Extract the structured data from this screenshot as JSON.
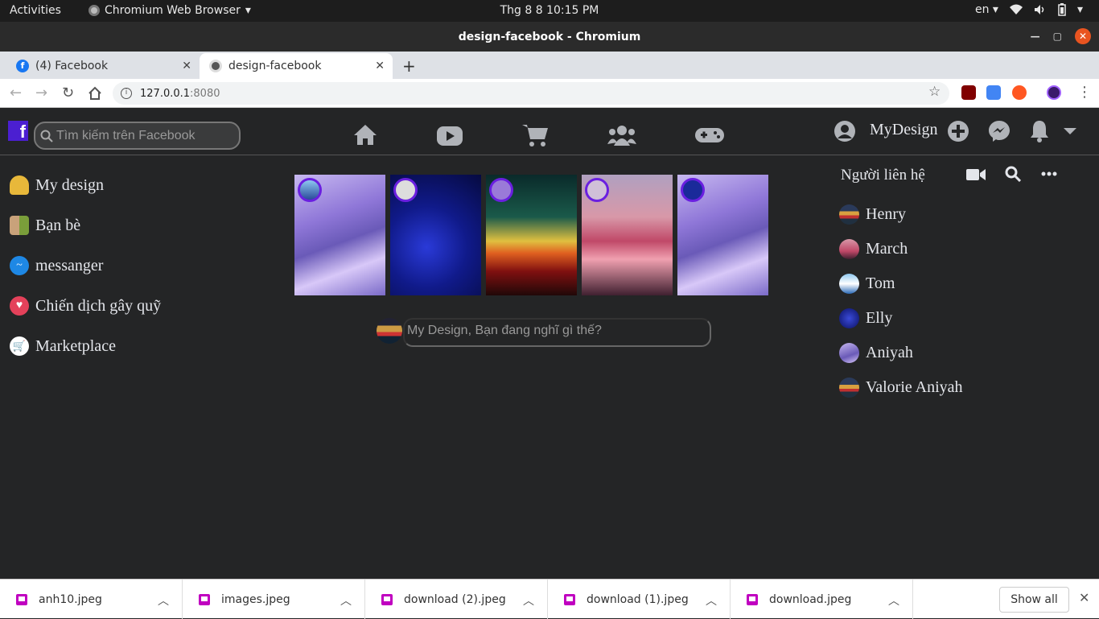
{
  "system_bar": {
    "activities": "Activities",
    "app_name": "Chromium Web Browser",
    "clock": "Thg 8 8  10:15 PM",
    "lang": "en"
  },
  "window": {
    "title": "design-facebook - Chromium"
  },
  "tabs": [
    {
      "label": "(4) Facebook",
      "active": false
    },
    {
      "label": "design-facebook",
      "active": true
    }
  ],
  "omnibox": {
    "host": "127.0.0.1",
    "port": ":8080"
  },
  "fb": {
    "search_placeholder": "Tìm kiếm trên Facebook",
    "username": "MyDesign",
    "left_menu": [
      {
        "label": "My design",
        "icon": "user-icon"
      },
      {
        "label": "Bạn bè",
        "icon": "friends-icon"
      },
      {
        "label": "messanger",
        "icon": "messenger-icon"
      },
      {
        "label": "Chiến dịch gây quỹ",
        "icon": "heart-icon"
      },
      {
        "label": "Marketplace",
        "icon": "cart-icon"
      }
    ],
    "post_placeholder": "My Design, Bạn đang nghĩ gì thế?",
    "contacts_title": "Người liên hệ",
    "contacts": [
      "Henry",
      "March",
      "Tom",
      "Elly",
      "Aniyah",
      "Valorie Aniyah"
    ]
  },
  "downloads": {
    "files": [
      "anh10.jpeg",
      "images.jpeg",
      "download (2).jpeg",
      "download (1).jpeg",
      "download.jpeg"
    ],
    "show_all": "Show all"
  },
  "colors": {
    "fb_bg": "#242526",
    "accent": "#6a1fe0",
    "text": "#e4e6eb"
  }
}
